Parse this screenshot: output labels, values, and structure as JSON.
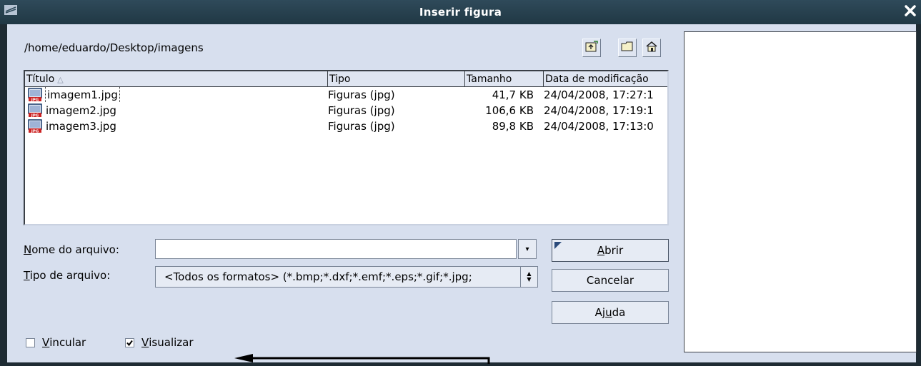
{
  "window": {
    "title": "Inserir figura"
  },
  "path": "/home/eduardo/Desktop/imagens",
  "columns": {
    "title": "Título",
    "type": "Tipo",
    "size": "Tamanho",
    "date": "Data de modificação"
  },
  "files": [
    {
      "name": "imagem1.jpg",
      "type": "Figuras (jpg)",
      "size": "41,7 KB",
      "date": "24/04/2008, 17:27:1"
    },
    {
      "name": "imagem2.jpg",
      "type": "Figuras (jpg)",
      "size": "106,6 KB",
      "date": "24/04/2008, 17:19:1"
    },
    {
      "name": "imagem3.jpg",
      "type": "Figuras (jpg)",
      "size": "89,8 KB",
      "date": "24/04/2008, 17:13:0"
    }
  ],
  "form": {
    "filename_label_u": "N",
    "filename_label_rest": "ome do arquivo:",
    "filename_value": "",
    "filetype_label_u": "T",
    "filetype_label_rest": "ipo de arquivo:",
    "filetype_value": "<Todos os formatos> (*.bmp;*.dxf;*.emf;*.eps;*.gif;*.jpg;"
  },
  "buttons": {
    "open_u": "A",
    "open_rest": "brir",
    "cancel": "Cancelar",
    "help_pre": "Aj",
    "help_u": "u",
    "help_rest": "da"
  },
  "options": {
    "link_u": "V",
    "link_rest": "incular",
    "link_checked": false,
    "preview_u": "V",
    "preview_rest": "isualizar",
    "preview_checked": true
  },
  "icons": {
    "up_folder": "folder-up-icon",
    "new_folder": "new-folder-icon",
    "home": "home-icon",
    "file": "jpg-file-icon",
    "close": "close-icon",
    "window_menu": "window-menu-icon"
  },
  "colors": {
    "titlebar": "#203844",
    "dialog_bg": "#d7dfee",
    "jpg_badge": "#cc2222"
  }
}
